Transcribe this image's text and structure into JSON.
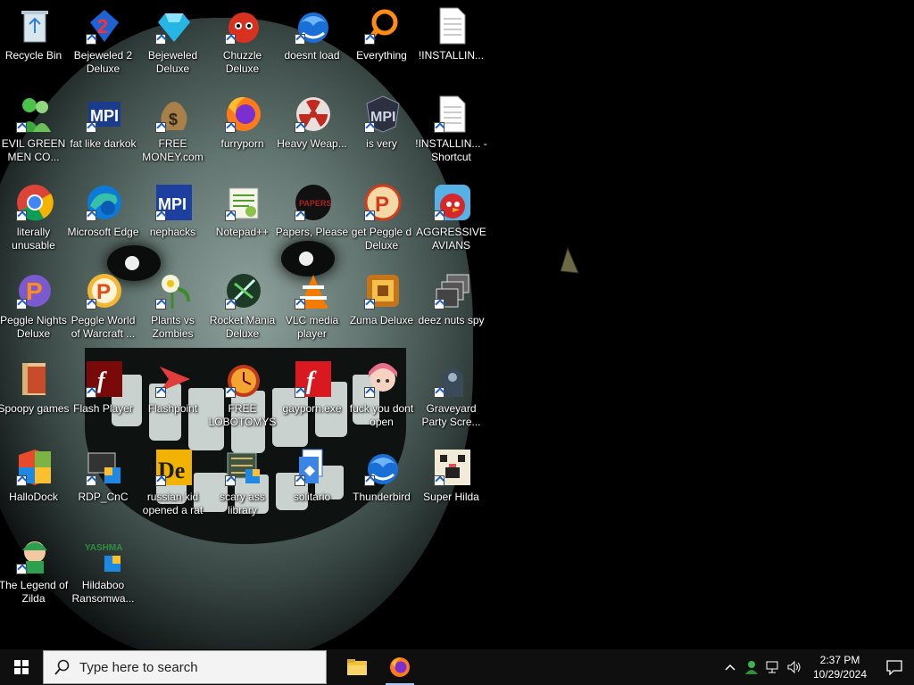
{
  "desktop": {
    "icons": [
      {
        "label": "Recycle Bin",
        "icon": "recycle-bin-icon",
        "shortcut": false
      },
      {
        "label": "EVIL GREEN MEN CO...",
        "icon": "messenger-icon",
        "shortcut": true
      },
      {
        "label": "literally unusable",
        "icon": "chrome-icon",
        "shortcut": true
      },
      {
        "label": "Peggle Nights Deluxe",
        "icon": "peggle-nights-icon",
        "shortcut": true
      },
      {
        "label": "Spoopy games",
        "icon": "folder-icon",
        "shortcut": false
      },
      {
        "label": "HalloDock",
        "icon": "windows-shield-icon",
        "shortcut": true
      },
      {
        "label": "The Legend of Zilda",
        "icon": "zelda-icon",
        "shortcut": true
      },
      {
        "label": "Bejeweled 2 Deluxe",
        "icon": "bejeweled2-icon",
        "shortcut": true
      },
      {
        "label": "fat like darkok",
        "icon": "mpi-icon",
        "shortcut": true
      },
      {
        "label": "Microsoft Edge",
        "icon": "edge-icon",
        "shortcut": true
      },
      {
        "label": "Peggle World of Warcraft ...",
        "icon": "peggle-icon",
        "shortcut": true
      },
      {
        "label": "Flash Player",
        "icon": "flash-icon",
        "shortcut": true
      },
      {
        "label": "RDP_CnC",
        "icon": "rdp-icon",
        "shortcut": true
      },
      {
        "label": "Hildaboo Ransomwa...",
        "icon": "yashma-icon",
        "shortcut": false
      },
      {
        "label": "Bejeweled Deluxe",
        "icon": "gem-icon",
        "shortcut": true
      },
      {
        "label": "FREE MONEY.com",
        "icon": "money-bag-icon",
        "shortcut": true
      },
      {
        "label": "nephacks",
        "icon": "mpi-blue-icon",
        "shortcut": true
      },
      {
        "label": "Plants vs Zombies",
        "icon": "pvz-flower-icon",
        "shortcut": true
      },
      {
        "label": "Flashpoint",
        "icon": "flashpoint-icon",
        "shortcut": true
      },
      {
        "label": "russian kid opened a rat",
        "icon": "dc-icon",
        "shortcut": true
      },
      {
        "label": "Chuzzle Deluxe",
        "icon": "chuzzle-icon",
        "shortcut": true
      },
      {
        "label": "furryporn",
        "icon": "firefox-icon",
        "shortcut": true
      },
      {
        "label": "Notepad++",
        "icon": "notepadpp-icon",
        "shortcut": true
      },
      {
        "label": "Rocket Mania Deluxe",
        "icon": "rocket-mania-icon",
        "shortcut": true
      },
      {
        "label": "FREE LOBOTOMYS",
        "icon": "clock-red-icon",
        "shortcut": true
      },
      {
        "label": "scary ass library",
        "icon": "library-icon",
        "shortcut": true
      },
      {
        "label": "doesnt load",
        "icon": "thunderbird-icon",
        "shortcut": true
      },
      {
        "label": "Heavy Weap...",
        "icon": "radiation-icon",
        "shortcut": true
      },
      {
        "label": "Papers, Please",
        "icon": "papers-please-icon",
        "shortcut": true
      },
      {
        "label": "VLC media player",
        "icon": "vlc-icon",
        "shortcut": true
      },
      {
        "label": "gayporn.exe",
        "icon": "flash-red-icon",
        "shortcut": true
      },
      {
        "label": "solitario",
        "icon": "solitaire-icon",
        "shortcut": true
      },
      {
        "label": "Everything",
        "icon": "everything-search-icon",
        "shortcut": true
      },
      {
        "label": "is very",
        "icon": "mpi-dark-icon",
        "shortcut": true
      },
      {
        "label": "get Peggle d Deluxe",
        "icon": "peggle-deluxe-icon",
        "shortcut": true
      },
      {
        "label": "Zuma Deluxe",
        "icon": "zuma-icon",
        "shortcut": true
      },
      {
        "label": "fuck you dont open",
        "icon": "anime-girl-icon",
        "shortcut": true
      },
      {
        "label": "Thunderbird",
        "icon": "thunderbird-icon",
        "shortcut": true
      },
      {
        "label": "!INSTALLIN...",
        "icon": "text-file-icon",
        "shortcut": false
      },
      {
        "label": "!INSTALLIN... - Shortcut",
        "icon": "text-file-icon",
        "shortcut": true
      },
      {
        "label": "AGGRESSIVE AVIANS",
        "icon": "angry-bird-icon",
        "shortcut": true
      },
      {
        "label": "deez nuts spy",
        "icon": "stacked-windows-icon",
        "shortcut": true
      },
      {
        "label": "Graveyard Party Scre...",
        "icon": "graveyard-icon",
        "shortcut": true
      },
      {
        "label": "Super Hilda",
        "icon": "pixel-dog-icon",
        "shortcut": true
      }
    ]
  },
  "taskbar": {
    "search_placeholder": "Type here to search",
    "clock_time": "2:37 PM",
    "clock_date": "10/29/2024"
  }
}
